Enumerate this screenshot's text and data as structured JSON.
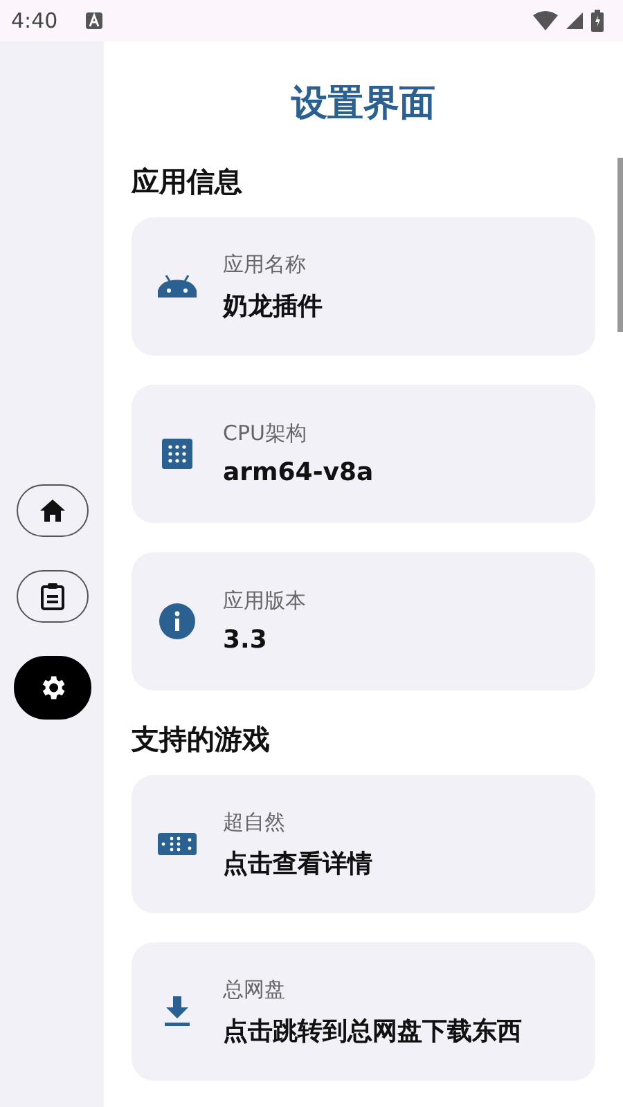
{
  "status_bar": {
    "time": "4:40"
  },
  "sidebar": {
    "items": [
      {
        "kind": "home",
        "selected": false
      },
      {
        "kind": "clipboard",
        "selected": false
      },
      {
        "kind": "settings",
        "selected": true
      }
    ]
  },
  "title": "设置界面",
  "sections": [
    {
      "heading": "应用信息",
      "items": [
        {
          "kind": "android",
          "label": "应用名称",
          "value": "奶龙插件"
        },
        {
          "kind": "grid",
          "label": "CPU架构",
          "value": "arm64-v8a"
        },
        {
          "kind": "info",
          "label": "应用版本",
          "value": "3.3"
        }
      ]
    },
    {
      "heading": "支持的游戏",
      "items": [
        {
          "kind": "dice",
          "label": "超自然",
          "value": "点击查看详情"
        },
        {
          "kind": "download",
          "label": "总网盘",
          "value": "点击跳转到总网盘下载东西"
        }
      ]
    }
  ]
}
